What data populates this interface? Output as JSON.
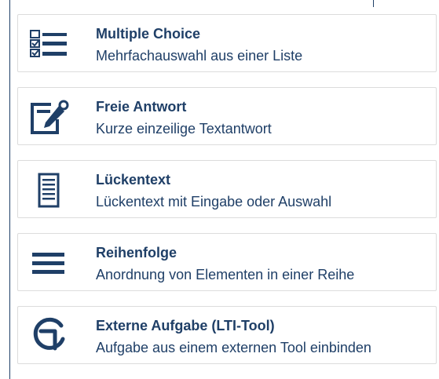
{
  "question_types": [
    {
      "title": "Multiple Choice",
      "description": "Mehrfachauswahl aus einer Liste",
      "icon": "multiple-choice-icon"
    },
    {
      "title": "Freie Antwort",
      "description": "Kurze einzeilige Textantwort",
      "icon": "free-answer-icon"
    },
    {
      "title": "Lückentext",
      "description": "Lückentext mit Eingabe oder Auswahl",
      "icon": "cloze-text-icon"
    },
    {
      "title": "Reihenfolge",
      "description": "Anordnung von Elementen in einer Reihe",
      "icon": "ordering-icon"
    },
    {
      "title": "Externe Aufgabe (LTI-Tool)",
      "description": "Aufgabe aus einem externen Tool einbinden",
      "icon": "external-tool-icon"
    }
  ],
  "colors": {
    "primary": "#1f3f67",
    "border": "#dcdcdc",
    "background": "#ffffff"
  }
}
